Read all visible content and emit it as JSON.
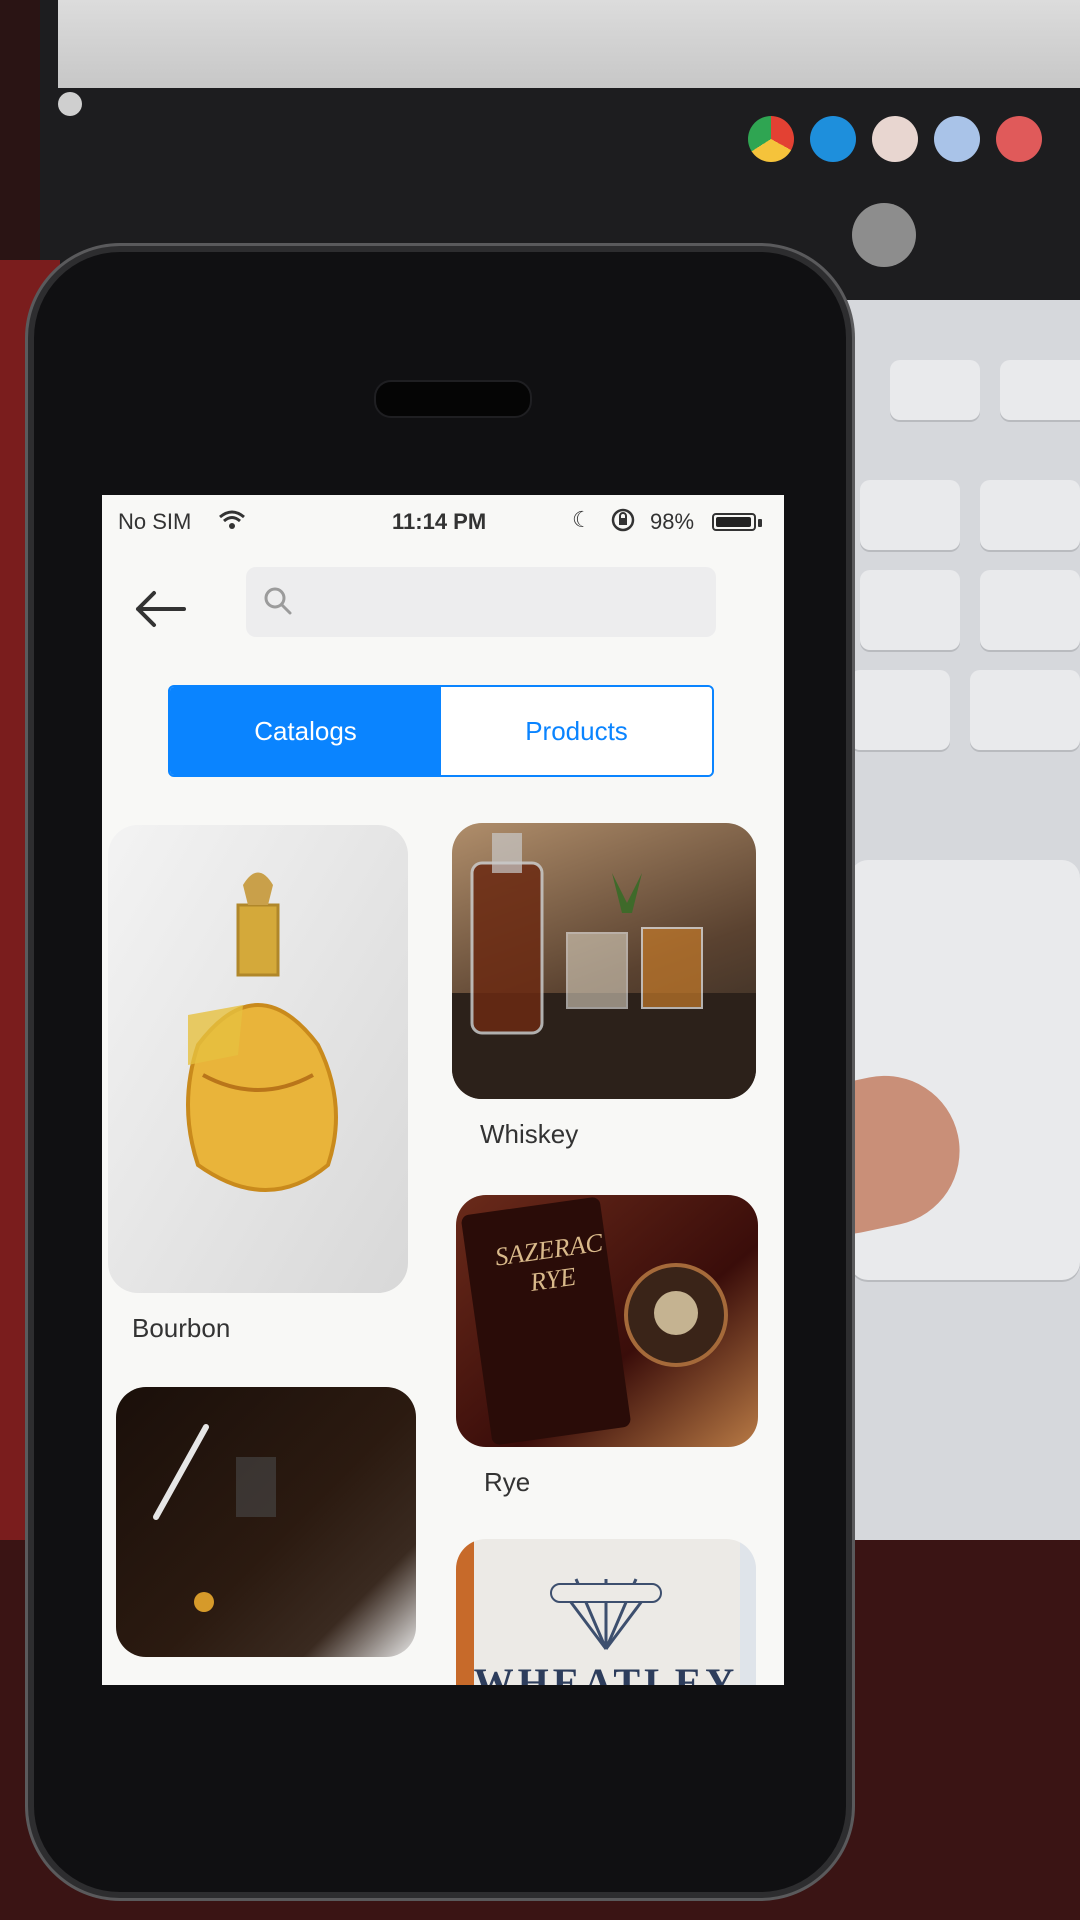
{
  "status_bar": {
    "carrier": "No SIM",
    "time": "11:14 PM",
    "battery": "98%",
    "battery_level": 0.98
  },
  "header": {
    "back_icon": "arrow-left-icon",
    "search_placeholder": "",
    "search_icon": "search-icon"
  },
  "tabs": [
    {
      "label": "Catalogs",
      "active": true
    },
    {
      "label": "Products",
      "active": false
    }
  ],
  "catalogs": [
    {
      "label": "Bourbon",
      "image": "bourbon-bottle-illustration"
    },
    {
      "label": "Whiskey",
      "image": "whiskey-decanter-glasses"
    },
    {
      "label": "Rye",
      "image": "sazerac-rye-bottle"
    },
    {
      "label": "",
      "image": "dark-bottle-photo"
    },
    {
      "label": "",
      "image": "wheatley-label"
    }
  ],
  "wheatley_brand": "WHEATLEY",
  "sazerac_label": "SAZERAC RYE",
  "colors": {
    "accent": "#0a84ff",
    "screen_bg": "#f8f8f6",
    "label_text": "#333333"
  }
}
